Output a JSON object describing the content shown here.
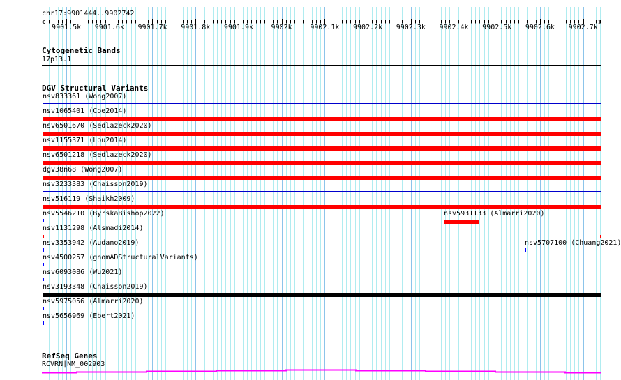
{
  "ruler": {
    "position": "chr17:9901444..9902742",
    "start": 9901444,
    "end": 9902742,
    "tick_labels": [
      "9901.5k",
      "9901.6k",
      "9901.7k",
      "9901.8k",
      "9901.9k",
      "9902k",
      "9902.1k",
      "9902.2k",
      "9902.3k",
      "9902.4k",
      "9902.5k",
      "9902.6k",
      "9902.7k"
    ]
  },
  "cytobands": {
    "title": "Cytogenetic Bands",
    "band": "17p13.1"
  },
  "dgv": {
    "title": "DGV Structural Variants",
    "rows": [
      [
        {
          "label": "nsv833361 (Wong2007)",
          "style": "line",
          "color": "#0000cc",
          "start": 9901444,
          "end": 9902742
        }
      ],
      [
        {
          "label": "nsv1065401 (Coe2014)",
          "style": "bar",
          "color": "#ff0000",
          "start": 9901444,
          "end": 9902742
        }
      ],
      [
        {
          "label": "nsv6501670 (Sedlazeck2020)",
          "style": "bar",
          "color": "#ff0000",
          "start": 9901444,
          "end": 9902742
        }
      ],
      [
        {
          "label": "nsv1155371 (Lou2014)",
          "style": "bar",
          "color": "#ff0000",
          "start": 9901444,
          "end": 9902742
        }
      ],
      [
        {
          "label": "nsv6501218 (Sedlazeck2020)",
          "style": "bar",
          "color": "#ff0000",
          "start": 9901444,
          "end": 9902742
        }
      ],
      [
        {
          "label": "dgv38n68 (Wong2007)",
          "style": "bar",
          "color": "#ff0000",
          "start": 9901444,
          "end": 9902742
        }
      ],
      [
        {
          "label": "nsv3233383 (Chaisson2019)",
          "style": "line",
          "color": "#0000cc",
          "start": 9901444,
          "end": 9902742
        }
      ],
      [
        {
          "label": "nsv516119 (Shaikh2009)",
          "style": "bar",
          "color": "#ff0000",
          "start": 9901444,
          "end": 9902742
        }
      ],
      [
        {
          "label": "nsv5546210 (ByrskaBishop2022)",
          "style": "tick",
          "color": "#0000ff",
          "start": 9901444,
          "end": 9901446
        },
        {
          "label": "nsv5931133 (Almarri2020)",
          "style": "bar",
          "color": "#ff0000",
          "start": 9902377,
          "end": 9902460
        }
      ],
      [
        {
          "label": "nsv1131298 (Alsmadi2014)",
          "style": "capline",
          "color": "#ff0000",
          "start": 9901444,
          "end": 9902742
        }
      ],
      [
        {
          "label": "nsv3353942 (Audano2019)",
          "style": "tick",
          "color": "#0000ff",
          "start": 9901444,
          "end": 9901446
        },
        {
          "label": "nsv5707100 (Chuang2021)",
          "style": "tick",
          "color": "#0000ff",
          "start": 9902564,
          "end": 9902566
        }
      ],
      [
        {
          "label": "nsv4500257 (gnomADStructuralVariants)",
          "style": "tick",
          "color": "#0000ff",
          "start": 9901444,
          "end": 9901446
        }
      ],
      [
        {
          "label": "nsv6093086 (Wu2021)",
          "style": "tick",
          "color": "#0000ff",
          "start": 9901444,
          "end": 9901446
        }
      ],
      [
        {
          "label": "nsv3193348 (Chaisson2019)",
          "style": "bar",
          "color": "#000000",
          "start": 9901444,
          "end": 9902742
        }
      ],
      [
        {
          "label": "nsv5975056 (Almarri2020)",
          "style": "tick",
          "color": "#0000ff",
          "start": 9901444,
          "end": 9901446
        }
      ],
      [
        {
          "label": "nsv5656969 (Ebert2021)",
          "style": "tick",
          "color": "#0000ff",
          "start": 9901444,
          "end": 9901446
        }
      ]
    ]
  },
  "refseq": {
    "title": "RefSeq Genes",
    "gene": "RCVRN|NM_002903",
    "color": "#ff00ff"
  },
  "colors": {
    "minor_grid": "#b0ecf0",
    "major_grid": "#8cc4ea"
  }
}
